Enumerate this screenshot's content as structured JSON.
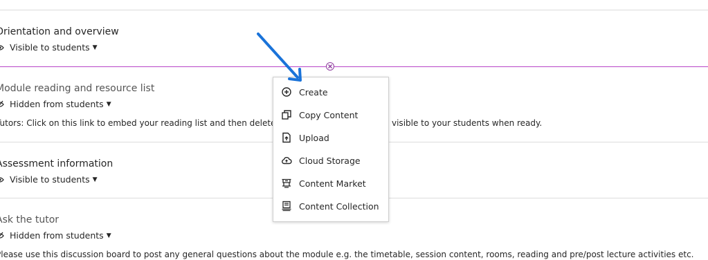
{
  "items": [
    {
      "title": "Orientation and overview",
      "visibility": "Visible to students"
    },
    {
      "title": "Module reading and resource list",
      "visibility": "Hidden from students",
      "description": "Tutors: Click on this link to embed your reading list and then delete th",
      "description_tail": "visible to your students when ready."
    },
    {
      "title": "Assessment information",
      "visibility": "Visible to students"
    },
    {
      "title": "Ask the tutor",
      "visibility": "Hidden from students",
      "description": "Please use this discussion board to post any general questions about the module e.g. the timetable, session content, rooms, reading and pre/post lecture activities etc."
    }
  ],
  "menu": {
    "items": [
      {
        "label": "Create",
        "icon": "plus-circle-icon"
      },
      {
        "label": "Copy Content",
        "icon": "copy-icon"
      },
      {
        "label": "Upload",
        "icon": "upload-icon"
      },
      {
        "label": "Cloud Storage",
        "icon": "cloud-icon"
      },
      {
        "label": "Content Market",
        "icon": "market-icon"
      },
      {
        "label": "Content Collection",
        "icon": "collection-icon"
      }
    ]
  },
  "colors": {
    "accent": "#b845c8",
    "arrow": "#1a73d9"
  }
}
